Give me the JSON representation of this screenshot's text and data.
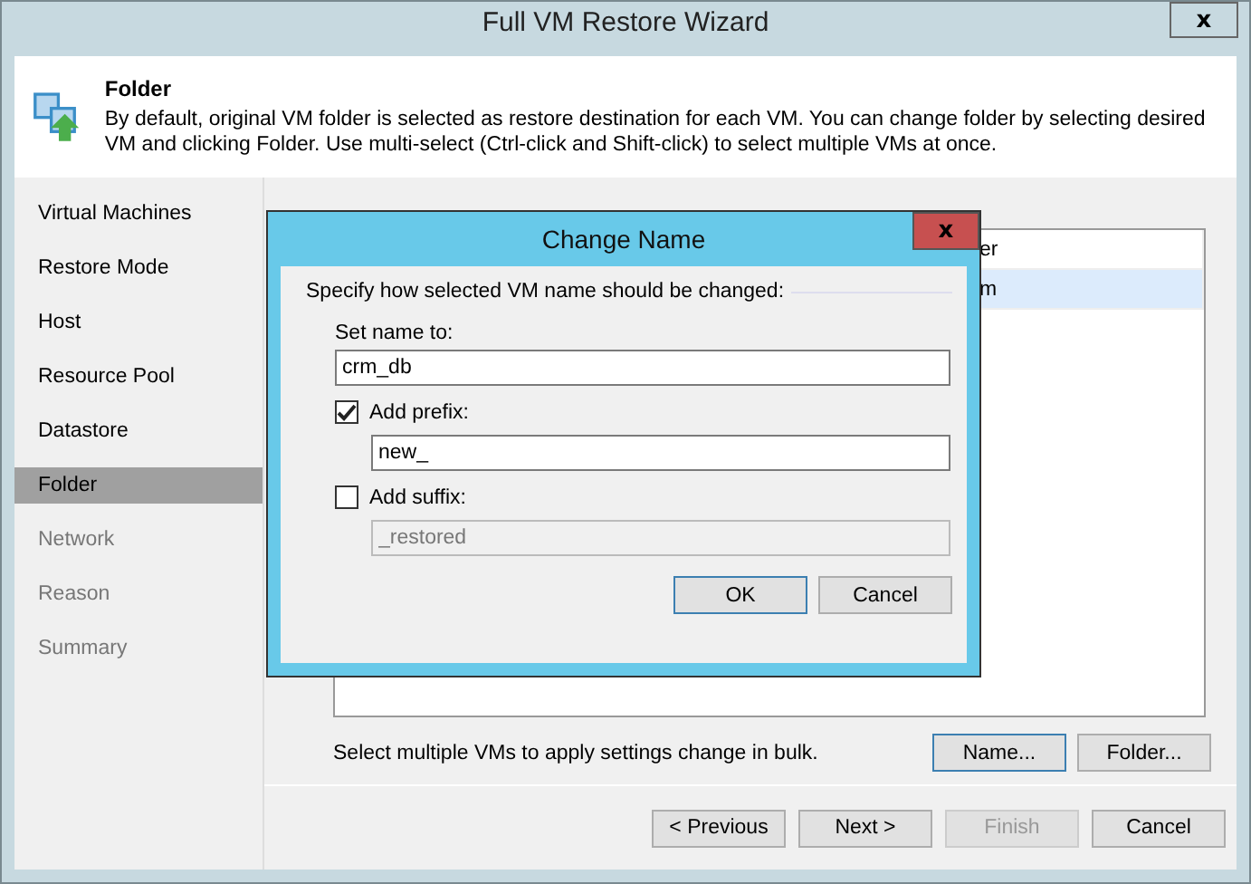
{
  "window": {
    "title": "Full VM Restore Wizard",
    "close": "x"
  },
  "header": {
    "title": "Folder",
    "description": "By default, original VM folder is selected as restore destination for each VM. You can change folder by selecting desired VM and clicking Folder. Use multi-select (Ctrl-click and Shift-click) to select multiple VMs at once."
  },
  "steps": [
    {
      "label": "Virtual Machines",
      "selected": false,
      "disabled": false
    },
    {
      "label": "Restore Mode",
      "selected": false,
      "disabled": false
    },
    {
      "label": "Host",
      "selected": false,
      "disabled": false
    },
    {
      "label": "Resource Pool",
      "selected": false,
      "disabled": false
    },
    {
      "label": "Datastore",
      "selected": false,
      "disabled": false
    },
    {
      "label": "Folder",
      "selected": true,
      "disabled": false
    },
    {
      "label": "Network",
      "selected": false,
      "disabled": true
    },
    {
      "label": "Reason",
      "selected": false,
      "disabled": true
    },
    {
      "label": "Summary",
      "selected": false,
      "disabled": true
    }
  ],
  "table": {
    "column_3": "er",
    "rows": [
      {
        "column_3": "m",
        "selected": true
      }
    ]
  },
  "hint": "Select multiple VMs to apply settings change in bulk.",
  "panel_buttons": [
    {
      "label": "Name...",
      "focused": true
    },
    {
      "label": "Folder...",
      "focused": false
    }
  ],
  "footer_buttons": [
    {
      "label": "< Previous",
      "disabled": false
    },
    {
      "label": "Next >",
      "disabled": false
    },
    {
      "label": "Finish",
      "disabled": true
    },
    {
      "label": "Cancel",
      "disabled": false
    }
  ],
  "dialog": {
    "title": "Change Name",
    "close": "x",
    "prompt": "Specify how selected VM name should be changed:",
    "name_label": "Set name to:",
    "name_value": "crm_db",
    "options": [
      {
        "label": "Add prefix:",
        "checked": true,
        "value": "new_"
      },
      {
        "label": "Add suffix:",
        "checked": false,
        "value": "_restored"
      }
    ],
    "buttons": [
      {
        "label": "OK",
        "focused": true
      },
      {
        "label": "Cancel",
        "focused": false
      }
    ]
  }
}
